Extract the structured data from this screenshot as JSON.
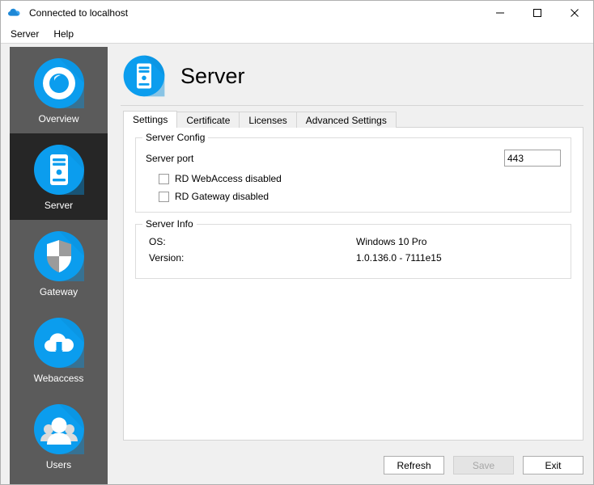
{
  "window": {
    "title": "Connected to localhost",
    "title_icon": "cloud-icon",
    "accent": "#0b9dee",
    "minimize_label": "minimize-icon",
    "maximize_label": "maximize-icon",
    "close_label": "close-icon"
  },
  "menubar": {
    "items": [
      {
        "label": "Server"
      },
      {
        "label": "Help"
      }
    ]
  },
  "sidebar": {
    "items": [
      {
        "label": "Overview",
        "icon": "overview-circle-icon",
        "selected": false
      },
      {
        "label": "Server",
        "icon": "server-tower-icon",
        "selected": true
      },
      {
        "label": "Gateway",
        "icon": "shield-icon",
        "selected": false
      },
      {
        "label": "Webaccess",
        "icon": "cloud-arrow-icon",
        "selected": false
      },
      {
        "label": "Users",
        "icon": "users-group-icon",
        "selected": false
      }
    ]
  },
  "page": {
    "title": "Server",
    "icon": "server-tower-icon"
  },
  "tabs": [
    {
      "label": "Settings",
      "active": true
    },
    {
      "label": "Certificate",
      "active": false
    },
    {
      "label": "Licenses",
      "active": false
    },
    {
      "label": "Advanced Settings",
      "active": false
    }
  ],
  "server_config": {
    "group_title": "Server Config",
    "port_label": "Server port",
    "port_value": "443",
    "port_placeholder": "",
    "checkboxes": [
      {
        "label": "RD WebAccess disabled",
        "checked": false
      },
      {
        "label": "RD Gateway disabled",
        "checked": false
      }
    ]
  },
  "server_info": {
    "group_title": "Server Info",
    "rows": [
      {
        "key": "OS:",
        "value": "Windows 10 Pro"
      },
      {
        "key": "Version:",
        "value": "1.0.136.0 - 7111e15"
      }
    ]
  },
  "footer": {
    "refresh_label": "Refresh",
    "save_label": "Save",
    "exit_label": "Exit",
    "save_enabled": false
  }
}
